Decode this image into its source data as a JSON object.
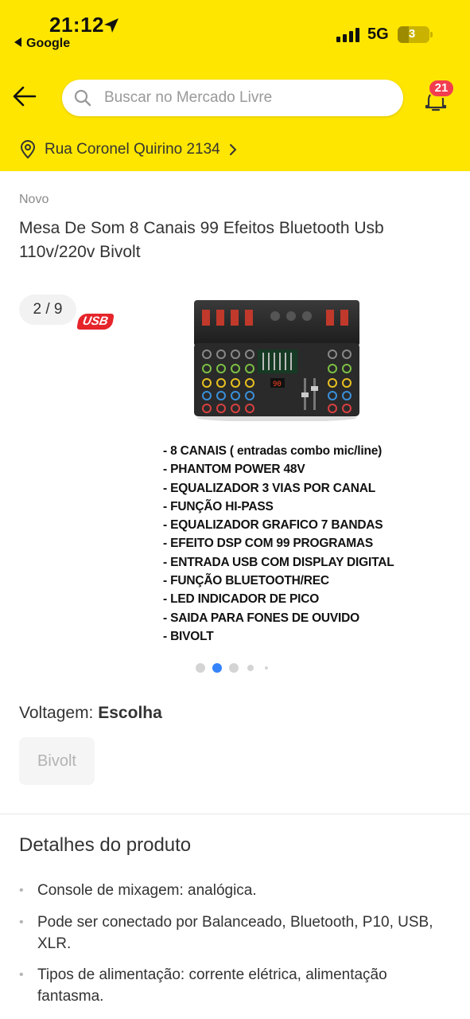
{
  "status_bar": {
    "time": "21:12",
    "back_app": "Google",
    "network": "5G",
    "battery": "3"
  },
  "header": {
    "search_placeholder": "Buscar no Mercado Livre",
    "notification_count": "21",
    "location": "Rua Coronel Quirino 2134",
    "brand_color": "#ffe600"
  },
  "product": {
    "condition": "Novo",
    "title": "Mesa De Som 8 Canais 99 Efeitos Bluetooth Usb 110v/220v Bivolt",
    "gallery": {
      "counter": "2 / 9",
      "badge": "USB",
      "features": [
        "- 8 CANAIS ( entradas combo mic/line)",
        "- PHANTOM POWER 48V",
        "- EQUALIZADOR 3 VIAS POR CANAL",
        "- FUNÇÃO HI-PASS",
        "- EQUALIZADOR GRAFICO 7 BANDAS",
        "- EFEITO DSP COM 99 PROGRAMAS",
        "- ENTRADA USB COM DISPLAY DIGITAL",
        "- FUNÇÃO BLUETOOTH/REC",
        "- LED INDICADOR DE PICO",
        "- SAIDA PARA FONES DE OUVIDO",
        "- BIVOLT"
      ],
      "active_dot": 2,
      "dot_color_active": "#3483fa"
    },
    "variation": {
      "label": "Voltagem:",
      "value": "Escolha",
      "option": "Bivolt"
    },
    "details": {
      "title": "Detalhes do produto",
      "items": [
        "Console de mixagem: analógica.",
        "Pode ser conectado por Balanceado, Bluetooth, P10, USB, XLR.",
        "Tipos de alimentação: corrente elétrica, alimentação fantasma."
      ]
    }
  }
}
